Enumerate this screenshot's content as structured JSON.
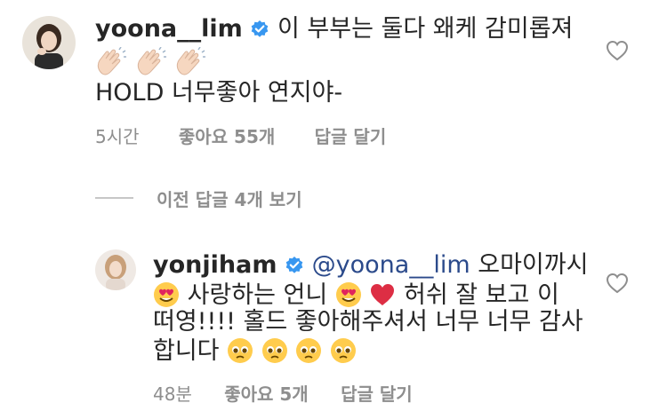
{
  "comment": {
    "username": "yoona__lim",
    "text_line1": "이 부부는 둘다 왜케 감미롭져",
    "emoji_line": [
      "clapping-hands",
      "clapping-hands",
      "clapping-hands"
    ],
    "text_line2": "HOLD 너무좋아 연지야-",
    "time": "5시간",
    "likes": "좋아요 55개",
    "reply": "답글 달기"
  },
  "view_replies": "이전 답글 4개 보기",
  "reply": {
    "username": "yonjiham",
    "mention": "@yoona__lim",
    "text_line1_after": "오마이까시",
    "text_line2_a": "사랑하는 언니",
    "text_line2_b": "허쉬 잘 보고 이",
    "text_line3": "떠영!!!! 홀드 좋아해주셔서 너무 너무 감사",
    "text_line4": "합니다",
    "time": "48분",
    "likes": "좋아요 5개",
    "reply": "답글 달기"
  },
  "colors": {
    "text": "#262626",
    "meta": "#8e8e8e",
    "mention": "#2b4a8b",
    "verified": "#3897f0"
  }
}
